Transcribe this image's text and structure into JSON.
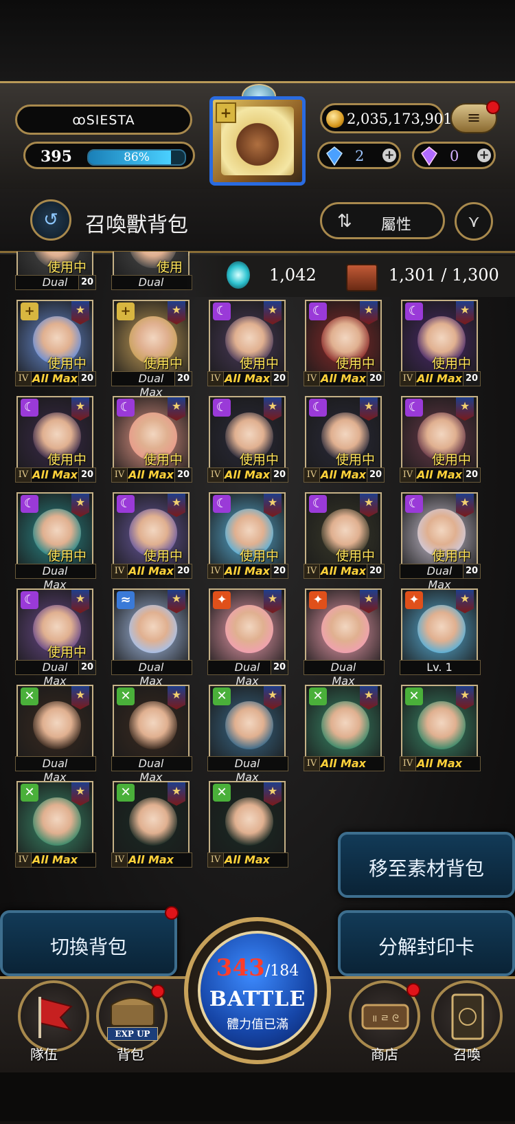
{
  "header": {
    "player_name": "ꝏSIESTA",
    "level": "395",
    "exp_percent": "86%",
    "exp_fraction": 0.86,
    "coins": "2,035,173,901",
    "diamonds": "2",
    "crystals": "0"
  },
  "title_bar": {
    "title": "召喚獸背包",
    "sort_label": "屬性"
  },
  "stats": {
    "soul": "1,042",
    "capacity": "1,301 / 1,300"
  },
  "partial_row": [
    {
      "attr": "light",
      "inuse": "使用中",
      "status": "Dual Max",
      "roman": "",
      "skill": "20"
    },
    {
      "attr": "light",
      "inuse": "使用",
      "status": "Dual Max",
      "roman": "",
      "skill": ""
    }
  ],
  "rows": [
    [
      {
        "attr": "light",
        "inuse": "使用中",
        "status": "All Max",
        "roman": "IV",
        "skill": "20",
        "art": "#6a8fd8"
      },
      {
        "attr": "light",
        "inuse": "使用中",
        "status": "Dual Max",
        "roman": "",
        "skill": "20",
        "art": "#c9a25a"
      },
      {
        "attr": "dark",
        "inuse": "使用中",
        "status": "All Max",
        "roman": "IV",
        "skill": "20",
        "art": "#4a3a5a"
      },
      {
        "attr": "dark",
        "inuse": "使用中",
        "status": "All Max",
        "roman": "IV",
        "skill": "20",
        "art": "#8a2a2a"
      },
      {
        "attr": "dark",
        "inuse": "使用中",
        "status": "All Max",
        "roman": "IV",
        "skill": "20",
        "art": "#4a2a6a"
      }
    ],
    [
      {
        "attr": "dark",
        "inuse": "使用中",
        "status": "All Max",
        "roman": "IV",
        "skill": "20",
        "art": "#3a2a4a"
      },
      {
        "attr": "dark",
        "inuse": "使用中",
        "status": "All Max",
        "roman": "IV",
        "skill": "20",
        "art": "#e89a8a"
      },
      {
        "attr": "dark",
        "inuse": "使用中",
        "status": "All Max",
        "roman": "IV",
        "skill": "20",
        "art": "#2a2a3a"
      },
      {
        "attr": "dark",
        "inuse": "使用中",
        "status": "All Max",
        "roman": "IV",
        "skill": "20",
        "art": "#2a2a3a"
      },
      {
        "attr": "dark",
        "inuse": "使用中",
        "status": "All Max",
        "roman": "IV",
        "skill": "20",
        "art": "#6a3a4a"
      }
    ],
    [
      {
        "attr": "dark",
        "inuse": "使用中",
        "status": "Dual Max",
        "roman": "",
        "skill": "",
        "art": "#2a8a8a"
      },
      {
        "attr": "dark",
        "inuse": "使用中",
        "status": "All Max",
        "roman": "IV",
        "skill": "20",
        "art": "#6a5aa0"
      },
      {
        "attr": "dark",
        "inuse": "使用中",
        "status": "All Max",
        "roman": "IV",
        "skill": "20",
        "art": "#5ab0d8"
      },
      {
        "attr": "dark",
        "inuse": "使用中",
        "status": "All Max",
        "roman": "IV",
        "skill": "20",
        "art": "#3a3a2a"
      },
      {
        "attr": "dark",
        "inuse": "使用中",
        "status": "Dual Max",
        "roman": "",
        "skill": "20",
        "art": "#d0c8d8"
      }
    ],
    [
      {
        "attr": "dark",
        "inuse": "使用中",
        "status": "Dual Max",
        "roman": "",
        "skill": "20",
        "art": "#6a4a8a"
      },
      {
        "attr": "water",
        "inuse": "",
        "status": "Dual Max",
        "roman": "",
        "skill": "",
        "art": "#a8c0e8"
      },
      {
        "attr": "fire",
        "inuse": "",
        "status": "Dual Max",
        "roman": "",
        "skill": "20",
        "art": "#f0a0b0"
      },
      {
        "attr": "fire",
        "inuse": "",
        "status": "Dual Max",
        "roman": "",
        "skill": "",
        "art": "#f0a0b0"
      },
      {
        "attr": "fire",
        "inuse": "",
        "status": "Lv. 1",
        "roman": "",
        "skill": "",
        "art": "#5ab0d8"
      }
    ],
    [
      {
        "attr": "wood",
        "inuse": "",
        "status": "Dual Max",
        "roman": "",
        "skill": "",
        "art": "#3a2a20"
      },
      {
        "attr": "wood",
        "inuse": "",
        "status": "Dual Max",
        "roman": "",
        "skill": "",
        "art": "#3a2a20"
      },
      {
        "attr": "wood",
        "inuse": "",
        "status": "Dual Max",
        "roman": "",
        "skill": "",
        "art": "#3a6a8a"
      },
      {
        "attr": "wood",
        "inuse": "",
        "status": "All Max",
        "roman": "IV",
        "skill": "",
        "art": "#3a8a6a"
      },
      {
        "attr": "wood",
        "inuse": "",
        "status": "All Max",
        "roman": "IV",
        "skill": "",
        "art": "#3a8a6a"
      }
    ],
    [
      {
        "attr": "wood",
        "inuse": "",
        "status": "All Max",
        "roman": "IV",
        "skill": "",
        "art": "#3a8a6a"
      },
      {
        "attr": "wood",
        "inuse": "",
        "status": "All Max",
        "roman": "IV",
        "skill": "",
        "art": "#1a2a24"
      },
      {
        "attr": "wood",
        "inuse": "",
        "status": "All Max",
        "roman": "IV",
        "skill": "",
        "art": "#1a2a24"
      }
    ]
  ],
  "actions": {
    "move_to_material": "移至素材背包",
    "switch_bag": "切換背包",
    "decompose_seal": "分解封印卡"
  },
  "battle": {
    "stamina_current": "343",
    "stamina_max": "/184",
    "label": "BATTLE",
    "sub": "體力值已滿"
  },
  "nav": {
    "team": "隊伍",
    "bag": "背包",
    "exp_up": "EXP UP",
    "shop": "商店",
    "summon": "召喚"
  },
  "colors": {
    "gold": "#a8894d",
    "allmax": "#ffd23a",
    "inuse": "#ffe45a",
    "accent_blue": "#1646a8",
    "notice_red": "#e0141a"
  }
}
